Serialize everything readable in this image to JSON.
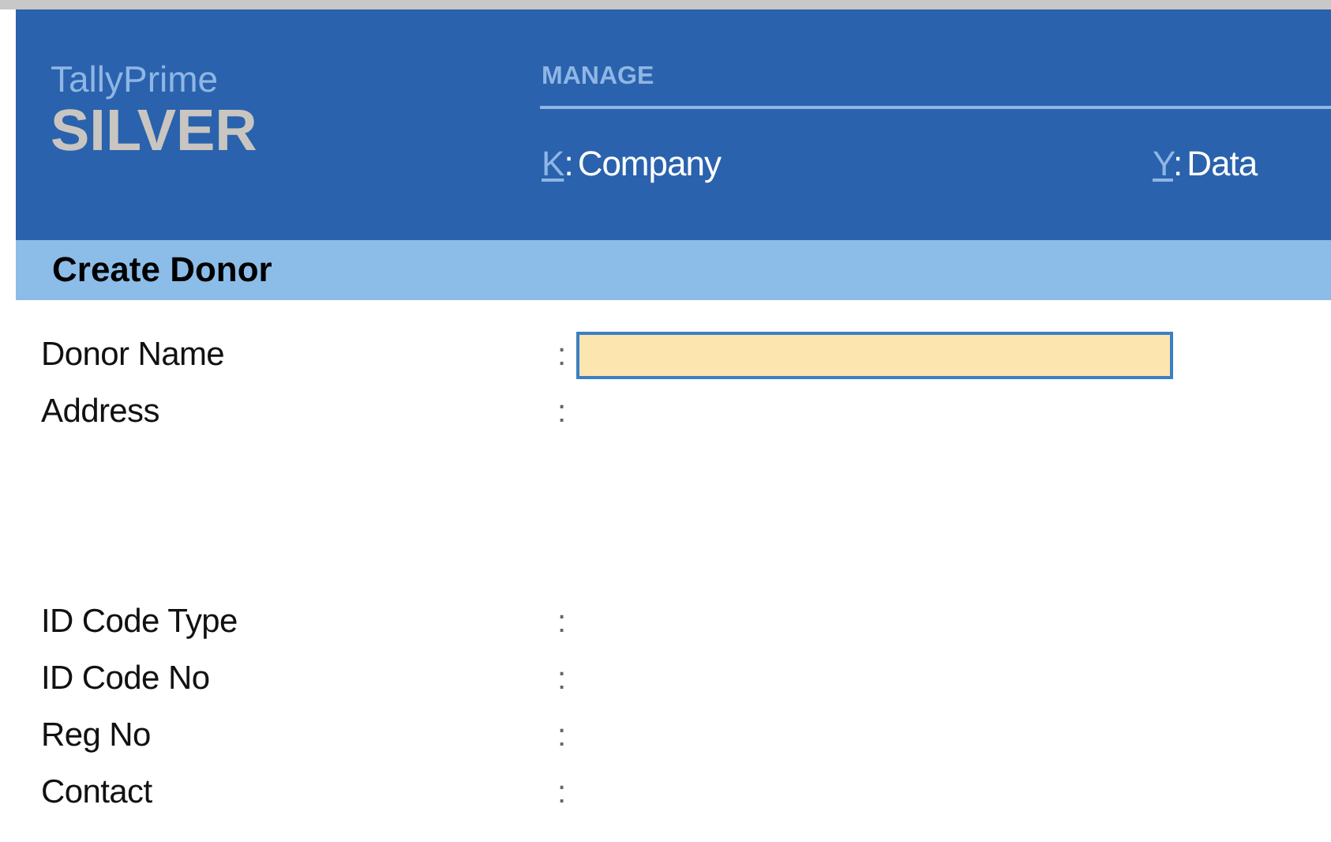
{
  "product": {
    "name": "TallyPrime",
    "edition": "SILVER"
  },
  "menu": {
    "title": "MANAGE",
    "items": [
      {
        "key": "K",
        "colon": ":",
        "label": "Company"
      },
      {
        "key": "Y",
        "colon": ":",
        "label": "Data"
      }
    ]
  },
  "form": {
    "title": "Create Donor",
    "fields": [
      {
        "label": "Donor Name",
        "colon": ":",
        "kind": "input"
      },
      {
        "label": "Address",
        "colon": ":",
        "kind": "multiline"
      },
      {
        "label": "ID Code Type",
        "colon": ":",
        "kind": "plain"
      },
      {
        "label": "ID Code No",
        "colon": ":",
        "kind": "plain"
      },
      {
        "label": "Reg No",
        "colon": ":",
        "kind": "plain"
      },
      {
        "label": "Contact",
        "colon": ":",
        "kind": "plain"
      }
    ]
  }
}
